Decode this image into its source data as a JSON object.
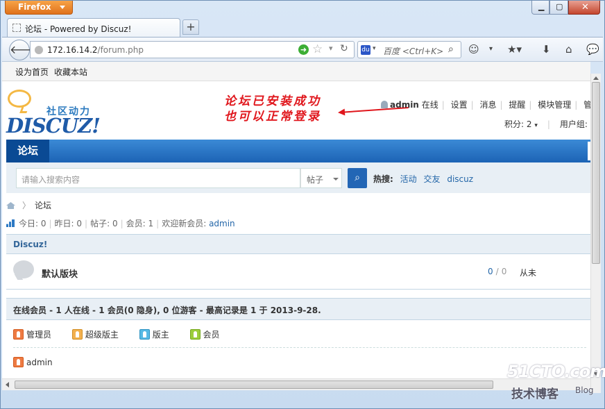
{
  "browser": {
    "menu_button": "Firefox",
    "tab_title": "论坛 - Powered by Discuz!",
    "new_tab": "+",
    "url_host": "172.16.14.2",
    "url_path": "/forum.php",
    "search_placeholder": "百度 <Ctrl+K>"
  },
  "bookmarks": {
    "set_home": "设为首页",
    "add_favorite": "收藏本站"
  },
  "header": {
    "logo_sub": "社区动力",
    "logo_main": "DISCUZ!",
    "annotation_line1": "论坛已安装成功",
    "annotation_line2": "也可以正常登录",
    "annotation_color": "#e0161c",
    "username": "admin",
    "online": "在线",
    "links": [
      "设置",
      "消息",
      "提醒",
      "模块管理",
      "管理中"
    ],
    "credits": "积分: 2",
    "usergroup": "用户组:"
  },
  "nav": {
    "active": "论坛",
    "accent": "#1c63b5"
  },
  "search": {
    "placeholder": "请输入搜索内容",
    "type": "帖子",
    "hot_label": "热搜:",
    "hot_terms": [
      "活动",
      "交友",
      "discuz"
    ]
  },
  "breadcrumb": {
    "current": "论坛"
  },
  "stats": {
    "today": "今日: 0",
    "yesterday": "昨日: 0",
    "posts": "帖子: 0",
    "members": "会员: 1",
    "welcome": "欢迎新会员:",
    "new_member": "admin"
  },
  "category": {
    "name": "Discuz!",
    "forum": {
      "name": "默认版块",
      "threads": "0",
      "posts": "0",
      "last_post": "从未"
    }
  },
  "online": {
    "summary": "在线会员 - 1 人在线 - 1 会员(0 隐身), 0 位游客 - 最高记录是 1 于 2013-9-28.",
    "legend": [
      "管理员",
      "超级版主",
      "版主",
      "会员"
    ],
    "users": [
      "admin"
    ]
  },
  "watermark": {
    "site": "51CTO.com",
    "sub": "技术博客",
    "blog": "Blog"
  }
}
